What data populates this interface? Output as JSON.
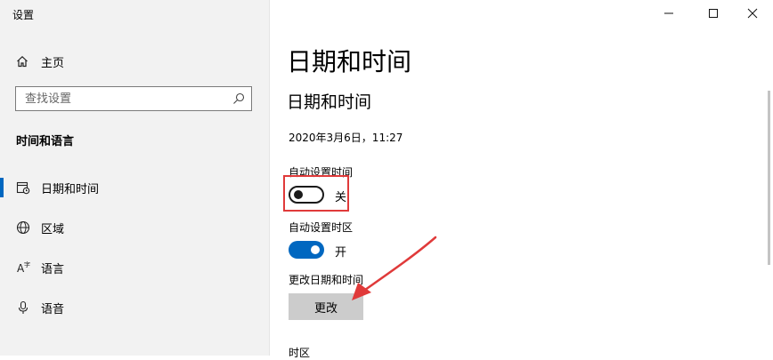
{
  "window": {
    "title": "设置",
    "controls": {
      "minimize_icon": "minimize-icon",
      "maximize_icon": "maximize-icon",
      "close_icon": "close-icon"
    }
  },
  "sidebar": {
    "home": {
      "icon": "home-icon",
      "label": "主页"
    },
    "search": {
      "placeholder": "查找设置",
      "icon": "search-icon"
    },
    "section_title": "时间和语言",
    "items": [
      {
        "label": "日期和时间",
        "icon": "calendar-clock-icon",
        "active": true
      },
      {
        "label": "区域",
        "icon": "globe-icon",
        "active": false
      },
      {
        "label": "语言",
        "icon": "language-icon",
        "active": false
      },
      {
        "label": "语音",
        "icon": "microphone-icon",
        "active": false
      }
    ]
  },
  "main": {
    "title": "日期和时间",
    "subtitle": "日期和时间",
    "current_datetime": "2020年3月6日，11:27",
    "auto_time": {
      "label": "自动设置时间",
      "state": "关",
      "on": false
    },
    "auto_timezone": {
      "label": "自动设置时区",
      "state": "开",
      "on": true
    },
    "change_datetime": {
      "label": "更改日期和时间",
      "button": "更改"
    },
    "timezone_label": "时区"
  },
  "colors": {
    "accent": "#0067c0",
    "annotation": "#e03a3a",
    "sidebar_bg": "#f2f2f2",
    "button_bg": "#cccccc"
  }
}
